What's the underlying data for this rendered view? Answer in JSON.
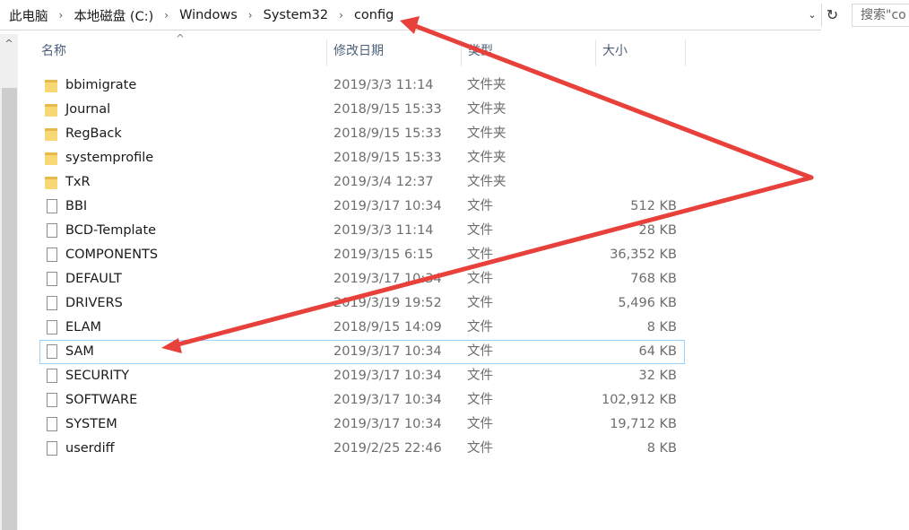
{
  "address_bar": {
    "crumbs": [
      "此电脑",
      "本地磁盘 (C:)",
      "Windows",
      "System32",
      "config"
    ],
    "dropdown_icon": "chevron-down-icon",
    "refresh_icon": "refresh-icon"
  },
  "search": {
    "text": "搜索\"co"
  },
  "columns": {
    "name": "名称",
    "date": "修改日期",
    "type": "类型",
    "size": "大小"
  },
  "files": [
    {
      "name": "bbimigrate",
      "date": "2019/3/3 11:14",
      "type": "文件夹",
      "size": "",
      "kind": "folder"
    },
    {
      "name": "Journal",
      "date": "2018/9/15 15:33",
      "type": "文件夹",
      "size": "",
      "kind": "folder"
    },
    {
      "name": "RegBack",
      "date": "2018/9/15 15:33",
      "type": "文件夹",
      "size": "",
      "kind": "folder"
    },
    {
      "name": "systemprofile",
      "date": "2018/9/15 15:33",
      "type": "文件夹",
      "size": "",
      "kind": "folder"
    },
    {
      "name": "TxR",
      "date": "2019/3/4 12:37",
      "type": "文件夹",
      "size": "",
      "kind": "folder"
    },
    {
      "name": "BBI",
      "date": "2019/3/17 10:34",
      "type": "文件",
      "size": "512 KB",
      "kind": "file"
    },
    {
      "name": "BCD-Template",
      "date": "2019/3/3 11:14",
      "type": "文件",
      "size": "28 KB",
      "kind": "file"
    },
    {
      "name": "COMPONENTS",
      "date": "2019/3/15 6:15",
      "type": "文件",
      "size": "36,352 KB",
      "kind": "file"
    },
    {
      "name": "DEFAULT",
      "date": "2019/3/17 10:34",
      "type": "文件",
      "size": "768 KB",
      "kind": "file"
    },
    {
      "name": "DRIVERS",
      "date": "2019/3/19 19:52",
      "type": "文件",
      "size": "5,496 KB",
      "kind": "file"
    },
    {
      "name": "ELAM",
      "date": "2018/9/15 14:09",
      "type": "文件",
      "size": "8 KB",
      "kind": "file"
    },
    {
      "name": "SAM",
      "date": "2019/3/17 10:34",
      "type": "文件",
      "size": "64 KB",
      "kind": "file",
      "selected": true
    },
    {
      "name": "SECURITY",
      "date": "2019/3/17 10:34",
      "type": "文件",
      "size": "32 KB",
      "kind": "file"
    },
    {
      "name": "SOFTWARE",
      "date": "2019/3/17 10:34",
      "type": "文件",
      "size": "102,912 KB",
      "kind": "file"
    },
    {
      "name": "SYSTEM",
      "date": "2019/3/17 10:34",
      "type": "文件",
      "size": "19,712 KB",
      "kind": "file"
    },
    {
      "name": "userdiff",
      "date": "2019/2/25 22:46",
      "type": "文件",
      "size": "8 KB",
      "kind": "file"
    }
  ],
  "annotation_color": "#e8403a"
}
